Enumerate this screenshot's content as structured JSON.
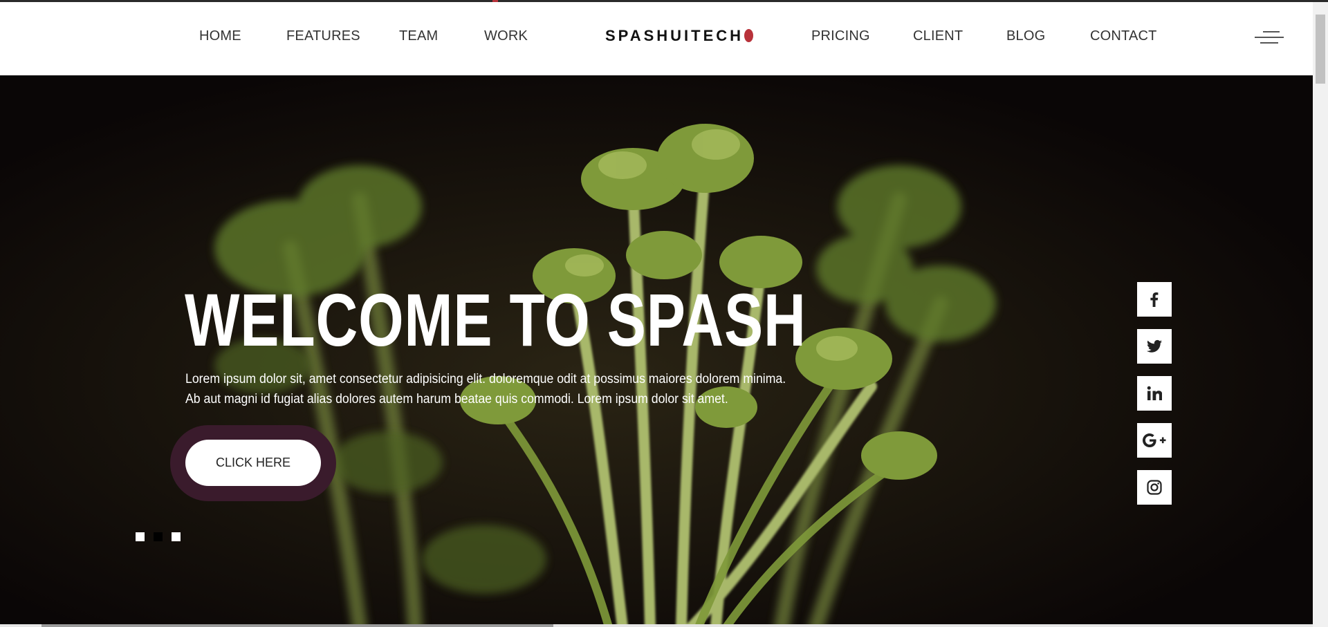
{
  "nav": {
    "left_items": [
      {
        "label": "HOME"
      },
      {
        "label": "FEATURES"
      },
      {
        "label": "TEAM"
      },
      {
        "label": "WORK"
      }
    ],
    "logo": "SPASHUITECH",
    "logo_dot_color": "#b8323a",
    "right_items": [
      {
        "label": "PRICING"
      },
      {
        "label": "CLIENT"
      },
      {
        "label": "BLOG"
      },
      {
        "label": "CONTACT"
      }
    ],
    "menu_icon": "hamburger-icon"
  },
  "hero": {
    "title": "WELCOME TO SPASH",
    "text_line1": "Lorem ipsum dolor sit, amet consectetur adipisicing elit. doloremque odit at possimus maiores dolorem minima.",
    "text_line2": "Ab aut magni id fugiat alias dolores autem harum beatae quis commodi. Lorem ipsum dolor sit amet.",
    "cta_label": "CLICK HERE",
    "cta_ring_color": "#3a1b2c"
  },
  "social": [
    "facebook-icon",
    "twitter-icon",
    "linkedin-icon",
    "google-plus-icon",
    "instagram-icon"
  ],
  "slider": {
    "slide_count": 3,
    "active_slide": 2
  },
  "colors": {
    "hero_background": "#0b0707",
    "plant_green": "#7f9a3a",
    "text": "#ffffff"
  }
}
